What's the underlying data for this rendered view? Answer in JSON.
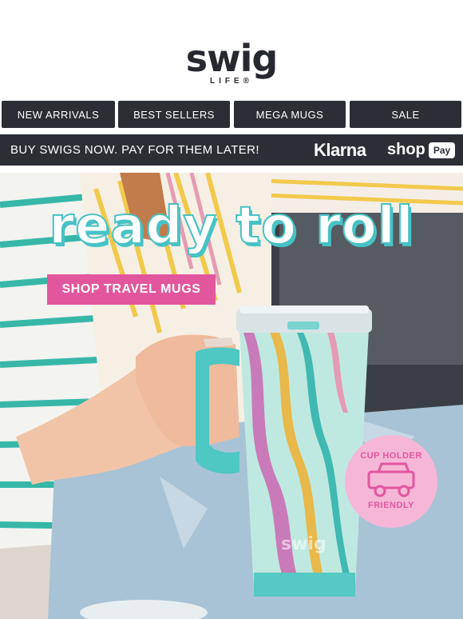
{
  "brand": {
    "logo_text": "swig",
    "logo_subtext": "LIFE®"
  },
  "nav": {
    "items": [
      {
        "label": "NEW ARRIVALS"
      },
      {
        "label": "BEST SELLERS"
      },
      {
        "label": "MEGA MUGS"
      },
      {
        "label": "SALE"
      }
    ]
  },
  "banner": {
    "text": "BUY SWIGS NOW. PAY FOR THEM LATER!",
    "klarna": "Klarna",
    "shop": "shop",
    "pay": "Pay"
  },
  "hero": {
    "headline": "ready to roll",
    "cta_label": "SHOP TRAVEL MUGS",
    "badge_top": "CUP HOLDER",
    "badge_bottom": "FRIENDLY",
    "mug_brand": "swig",
    "colors": {
      "accent_teal": "#48c2c6",
      "accent_pink": "#e2569e",
      "badge_pink": "#f6b7d7",
      "dark": "#2b2f35"
    }
  }
}
